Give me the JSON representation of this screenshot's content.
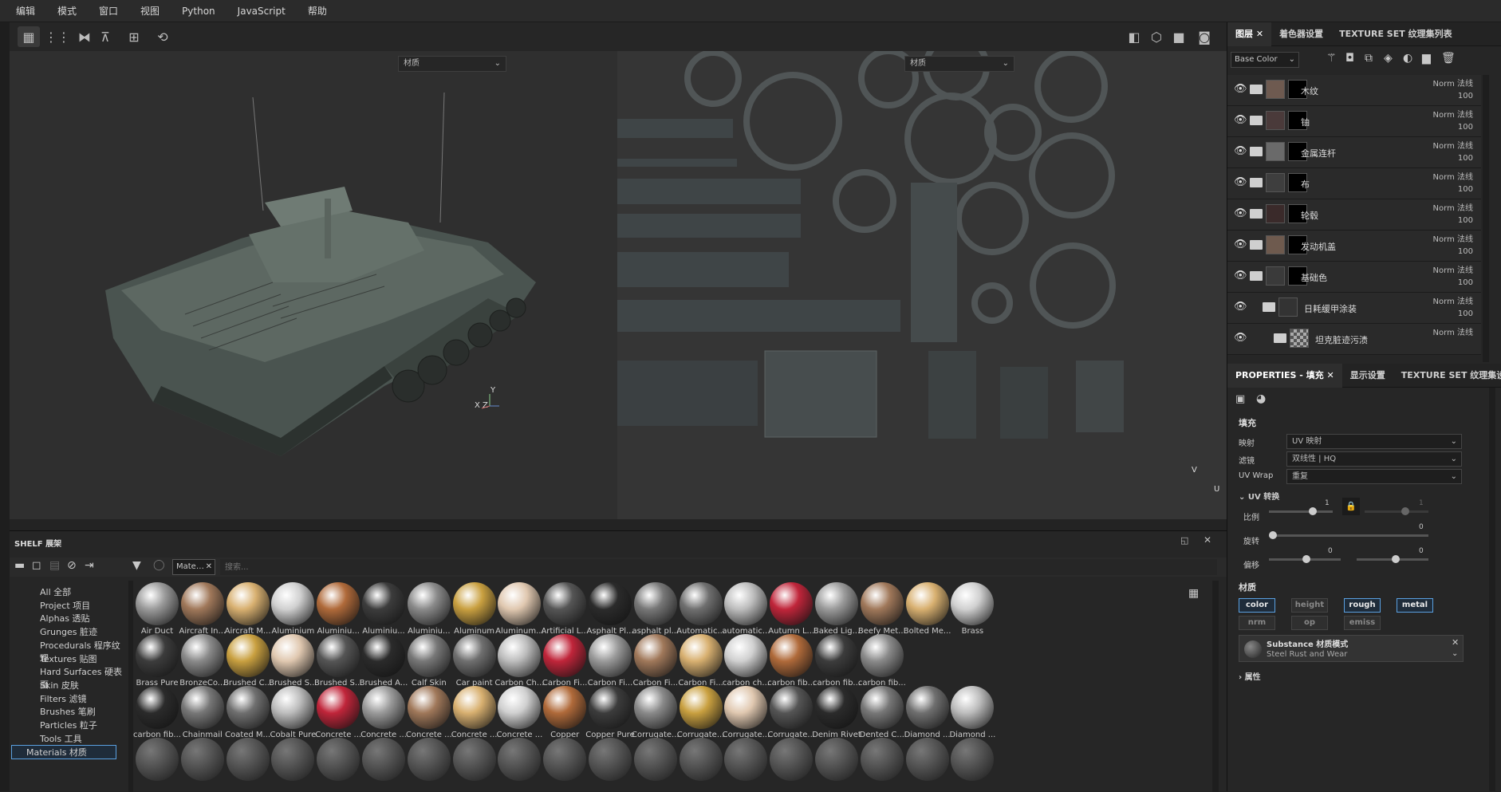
{
  "menubar": [
    "编辑",
    "模式",
    "窗口",
    "视图",
    "Python",
    "JavaScript",
    "帮助"
  ],
  "viewport3d": {
    "dropdown": "材质",
    "axis_y": "Y",
    "axis_xz": "X Z"
  },
  "viewport2d": {
    "dropdown": "材质",
    "axis_v": "V",
    "axis_u": "U"
  },
  "right_tabs": [
    "图层",
    "着色器设置",
    "TEXTURE SET 纹理集列表"
  ],
  "channel": "Base Color",
  "layers": [
    {
      "name": "木纹",
      "blend": "Norm 法线",
      "opacity": "100"
    },
    {
      "name": "铀",
      "blend": "Norm 法线",
      "opacity": "100"
    },
    {
      "name": "金属连杆",
      "blend": "Norm 法线",
      "opacity": "100"
    },
    {
      "name": "布",
      "blend": "Norm 法线",
      "opacity": "100"
    },
    {
      "name": "轮毂",
      "blend": "Norm 法线",
      "opacity": "100"
    },
    {
      "name": "发动机盖",
      "blend": "Norm 法线",
      "opacity": "100"
    },
    {
      "name": "基础色",
      "blend": "Norm 法线",
      "opacity": "100"
    },
    {
      "name": "日耗缓甲涂装",
      "blend": "Norm 法线",
      "opacity": "100"
    },
    {
      "name": "坦克脏迹污渍",
      "blend": "Norm 法线",
      "opacity": ""
    }
  ],
  "props_tabs": [
    "PROPERTIES - 填充",
    "显示设置",
    "TEXTURE SET 纹理集设置"
  ],
  "fill": {
    "title": "填充",
    "mapping_label": "映射",
    "mapping": "UV 映射",
    "filter_label": "滤镜",
    "filter": "双线性 | HQ",
    "wrap_label": "UV Wrap",
    "wrap": "重复",
    "uv_transform": "UV 转换",
    "scale_label": "比例",
    "scale": "1",
    "rotation_label": "旋转",
    "rotation": "0",
    "offset_label": "偏移",
    "offset_a": "0",
    "offset_b": "0",
    "scale_b": "1",
    "rot_b": "0"
  },
  "material": {
    "title": "材质",
    "channels": [
      "color",
      "height",
      "rough",
      "metal",
      "nrm",
      "op",
      "emiss"
    ],
    "active": [
      "color",
      "rough",
      "metal"
    ],
    "substance_title": "Substance 材质模式",
    "substance_name": "Steel Rust and Wear",
    "properties": "属性"
  },
  "shelf": {
    "title": "SHELF 展架",
    "filter_chip": "Mate…",
    "search_placeholder": "搜索...",
    "categories": [
      "All 全部",
      "Project 项目",
      "Alphas 透贴",
      "Grunges 脏迹",
      "Procedurals 程序纹理",
      "Textures 贴图",
      "Hard Surfaces 硬表面",
      "Skin 皮肤",
      "Filters 滤镜",
      "Brushes 笔刷",
      "Particles 粒子",
      "Tools 工具",
      "Materials 材质"
    ],
    "selected_category": "Materials 材质",
    "materials_row1": [
      "Air Duct",
      "Aircraft In...",
      "Aircraft M...",
      "Aluminium",
      "Aluminiu...",
      "Aluminiu...",
      "Aluminiu...",
      "Aluminum",
      "Aluminum...",
      "Artificial L...",
      "Asphalt Pl...",
      "asphalt pl...",
      "Automatic...",
      "automatic...",
      "Autumn L...",
      "Baked Lig...",
      "Beefy Met...",
      "Bolted Me...",
      "Brass"
    ],
    "materials_row2": [
      "Brass Pure",
      "BronzeCo...",
      "Brushed C...",
      "Brushed S...",
      "Brushed S...",
      "Brushed A...",
      "Calf Skin",
      "Car paint",
      "Carbon Ch...",
      "Carbon Fi...",
      "Carbon Fi...",
      "Carbon Fi...",
      "Carbon Fi...",
      "carbon ch...",
      "carbon fib...",
      "carbon fib...",
      "carbon fib..."
    ],
    "materials_row3": [
      "carbon fib...",
      "Chainmail",
      "Coated M...",
      "Cobalt Pure",
      "Concrete ...",
      "Concrete ...",
      "Concrete ...",
      "Concrete ...",
      "Concrete ...",
      "Copper",
      "Copper Pure",
      "Corrugate...",
      "Corrugate...",
      "Corrugate...",
      "Corrugate...",
      "Denim Rivet",
      "Dented C...",
      "Diamond ...",
      "Diamond ..."
    ]
  },
  "colors": {
    "accent": "#5aa0e0",
    "bg": "#262626"
  }
}
